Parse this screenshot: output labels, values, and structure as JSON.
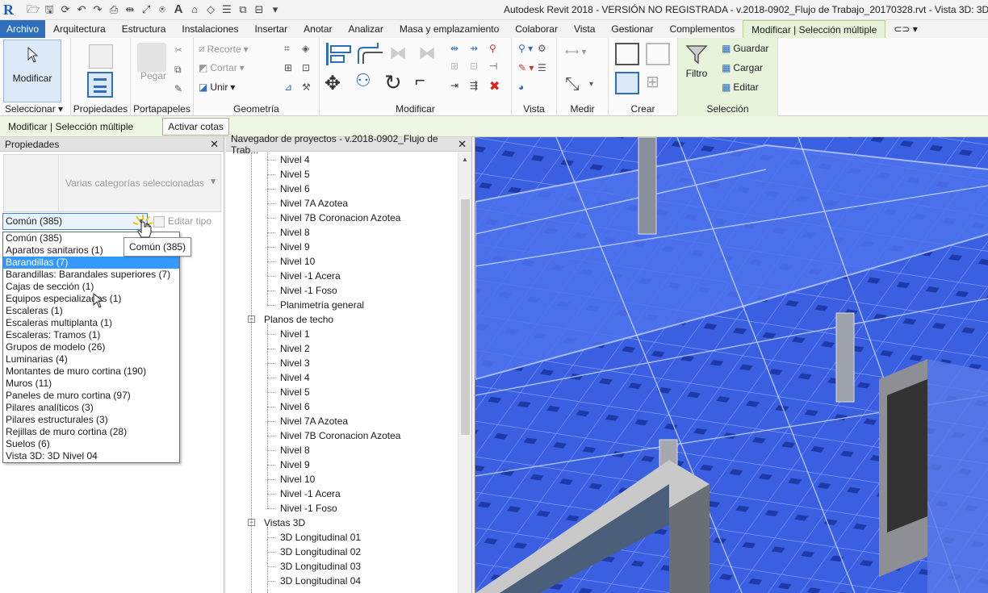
{
  "app": {
    "title": "Autodesk Revit 2018 - VERSIÓN NO REGISTRADA -    v.2018-0902_Flujo de Trabajo_20170328.rvt - Vista 3D: 3D Nivel"
  },
  "tabs": [
    "Archivo",
    "Arquitectura",
    "Estructura",
    "Instalaciones",
    "Insertar",
    "Anotar",
    "Analizar",
    "Masa y emplazamiento",
    "Colaborar",
    "Vista",
    "Gestionar",
    "Complementos",
    "Modificar | Selección múltiple"
  ],
  "ribbon": {
    "modificar_label": "Modificar",
    "seleccionar_label": "Seleccionar ▾",
    "propiedades_label": "Propiedades",
    "portapapeles_label": "Portapapeles",
    "pegar_label": "Pegar",
    "geometria_label": "Geometría",
    "recorte_label": "Recorte",
    "cortar_label": "Cortar",
    "unir_label": "Unir",
    "modificar_panel_label": "Modificar",
    "vista_label": "Vista",
    "medir_label": "Medir",
    "crear_label": "Crear",
    "filtro_label": "Filtro",
    "guardar_label": "Guardar",
    "cargar_label": "Cargar",
    "editar_label": "Editar",
    "seleccion_label": "Selección"
  },
  "context_bar": {
    "label": "Modificar | Selección múltiple",
    "button": "Activar cotas"
  },
  "properties": {
    "header": "Propiedades",
    "type_label": "Varias categorías seleccionadas",
    "combo_value": "Común (385)",
    "edit_type": "Editar tipo",
    "tooltip": "Común (385)",
    "options": [
      "Común (385)",
      "Aparatos sanitarios (1)",
      "Barandillas (7)",
      "Barandillas: Barandales superiores (7)",
      "Cajas de sección (1)",
      "Equipos especializados (1)",
      "Escaleras (1)",
      "Escaleras multiplanta (1)",
      "Escaleras: Tramos (1)",
      "Grupos de modelo (26)",
      "Luminarias (4)",
      "Montantes de muro cortina (190)",
      "Muros (11)",
      "Paneles de muro cortina (97)",
      "Pilares analíticos (3)",
      "Pilares estructurales (3)",
      "Rejillas de muro cortina (28)",
      "Suelos (6)",
      "Vista 3D: 3D Nivel 04"
    ],
    "selected_index": 2
  },
  "browser": {
    "header": "Navegador de proyectos - v.2018-0902_Flujo de Trab...",
    "floor_plans_tail": [
      "Nivel 4",
      "Nivel 5",
      "Nivel 6",
      "Nivel 7A Azotea",
      "Nivel 7B Coronacion Azotea",
      "Nivel 8",
      "Nivel 9",
      "Nivel 10",
      "Nivel -1 Acera",
      "Nivel -1 Foso",
      "Planimetría general"
    ],
    "ceiling_group": "Planos de techo",
    "ceiling_plans": [
      "Nivel 1",
      "Nivel 2",
      "Nivel 3",
      "Nivel 4",
      "Nivel 5",
      "Nivel 6",
      "Nivel 7A Azotea",
      "Nivel 7B Coronacion Azotea",
      "Nivel 8",
      "Nivel 9",
      "Nivel 10",
      "Nivel -1 Acera",
      "Nivel -1 Foso"
    ],
    "views3d_group": "Vistas 3D",
    "views3d": [
      "3D Longitudinal 01",
      "3D Longitudinal 02",
      "3D Longitudinal 03",
      "3D Longitudinal 04"
    ]
  },
  "colors": {
    "selection_blue": "#2b4fd6",
    "file_tab": "#2e6ebd",
    "context_green": "#e8f3dc"
  }
}
